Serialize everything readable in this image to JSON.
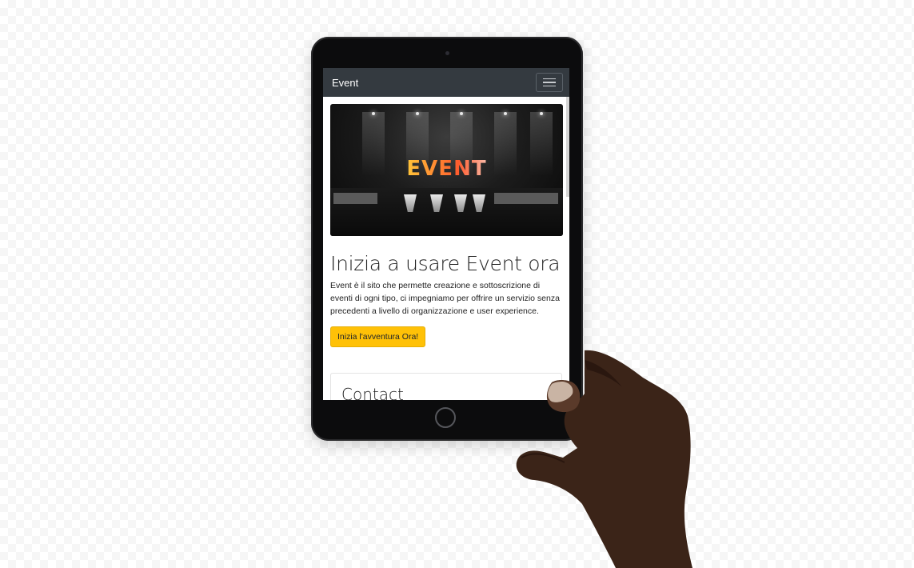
{
  "app": {
    "brand": "Event"
  },
  "navbar": {
    "toggle_icon": "hamburger-menu-icon"
  },
  "hero": {
    "logo_text": "EVENT"
  },
  "main": {
    "heading": "Inizia a usare Event ora",
    "description": "Event è il sito che permette creazione e sottoscrizione di eventi di ogni tipo, ci impegniamo per offrire un servizio senza precedenti a livello di organizzazione e user experience.",
    "cta_label": "Inizia l'avventura Ora!"
  },
  "contact": {
    "title": "Contact"
  },
  "colors": {
    "navbar_bg": "#343a40",
    "cta_bg": "#ffc107"
  }
}
